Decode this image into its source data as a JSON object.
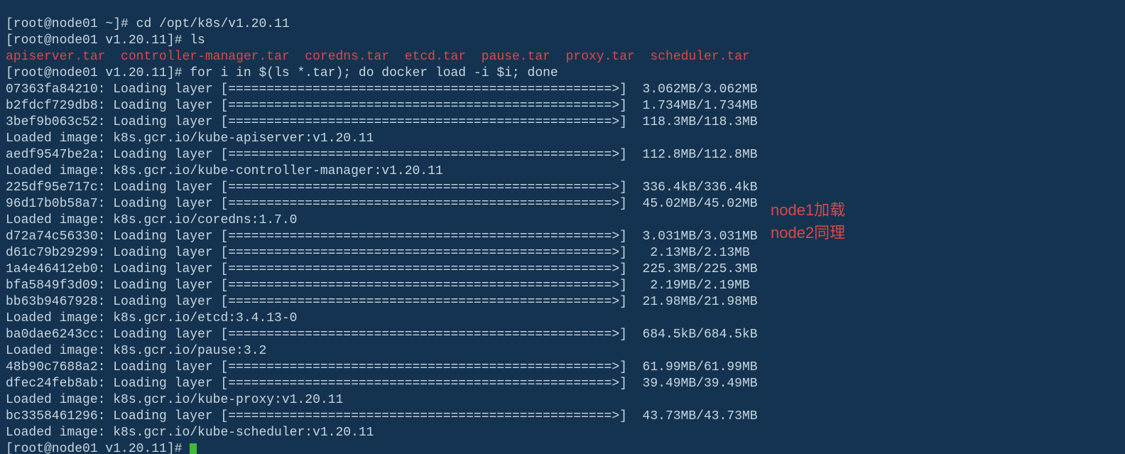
{
  "prompts": {
    "line0_partial": "",
    "p1_prompt": "[root@node01 ~]# ",
    "p1_cmd": "cd /opt/k8s/v1.20.11",
    "p2_prompt": "[root@node01 v1.20.11]# ",
    "p2_cmd": "ls",
    "p3_prompt": "[root@node01 v1.20.11]# ",
    "p3_cmd": "for i in $(ls *.tar); do docker load -i $i; done",
    "final_prompt": "[root@node01 v1.20.11]# "
  },
  "tar_files": [
    "apiserver.tar",
    "controller-manager.tar",
    "coredns.tar",
    "etcd.tar",
    "pause.tar",
    "proxy.tar",
    "scheduler.tar"
  ],
  "lines": [
    {
      "hash": "07363fa84210",
      "text": "Loading layer",
      "size": "3.062MB/3.062MB"
    },
    {
      "hash": "b2fdcf729db8",
      "text": "Loading layer",
      "size": "1.734MB/1.734MB"
    },
    {
      "hash": "3bef9b063c52",
      "text": "Loading layer",
      "size": "118.3MB/118.3MB"
    },
    {
      "loaded": "Loaded image: k8s.gcr.io/kube-apiserver:v1.20.11"
    },
    {
      "hash": "aedf9547be2a",
      "text": "Loading layer",
      "size": "112.8MB/112.8MB"
    },
    {
      "loaded": "Loaded image: k8s.gcr.io/kube-controller-manager:v1.20.11"
    },
    {
      "hash": "225df95e717c",
      "text": "Loading layer",
      "size": "336.4kB/336.4kB"
    },
    {
      "hash": "96d17b0b58a7",
      "text": "Loading layer",
      "size": "45.02MB/45.02MB"
    },
    {
      "loaded": "Loaded image: k8s.gcr.io/coredns:1.7.0"
    },
    {
      "hash": "d72a74c56330",
      "text": "Loading layer",
      "size": "3.031MB/3.031MB"
    },
    {
      "hash": "d61c79b29299",
      "text": "Loading layer",
      "size": " 2.13MB/2.13MB"
    },
    {
      "hash": "1a4e46412eb0",
      "text": "Loading layer",
      "size": "225.3MB/225.3MB"
    },
    {
      "hash": "bfa5849f3d09",
      "text": "Loading layer",
      "size": " 2.19MB/2.19MB"
    },
    {
      "hash": "bb63b9467928",
      "text": "Loading layer",
      "size": "21.98MB/21.98MB"
    },
    {
      "loaded": "Loaded image: k8s.gcr.io/etcd:3.4.13-0"
    },
    {
      "hash": "ba0dae6243cc",
      "text": "Loading layer",
      "size": "684.5kB/684.5kB"
    },
    {
      "loaded": "Loaded image: k8s.gcr.io/pause:3.2"
    },
    {
      "hash": "48b90c7688a2",
      "text": "Loading layer",
      "size": "61.99MB/61.99MB"
    },
    {
      "hash": "dfec24feb8ab",
      "text": "Loading layer",
      "size": "39.49MB/39.49MB"
    },
    {
      "loaded": "Loaded image: k8s.gcr.io/kube-proxy:v1.20.11"
    },
    {
      "hash": "bc3358461296",
      "text": "Loading layer",
      "size": "43.73MB/43.73MB"
    },
    {
      "loaded": "Loaded image: k8s.gcr.io/kube-scheduler:v1.20.11"
    }
  ],
  "progress_bar": "[==================================================>]",
  "annotation": {
    "line1": "node1加载",
    "line2": "node2同理"
  }
}
